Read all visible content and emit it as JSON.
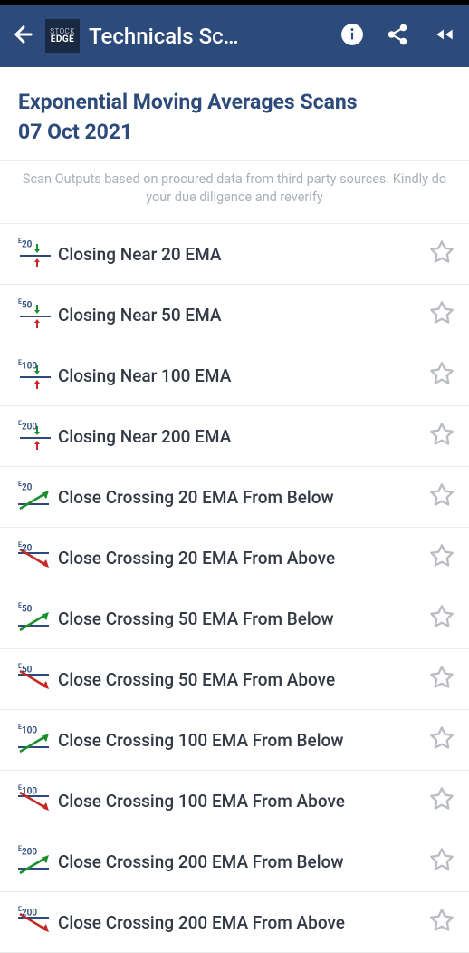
{
  "header": {
    "title": "Technicals Sc…",
    "logo_line1": "STOCK",
    "logo_line2": "EDGE"
  },
  "page": {
    "title_line1": "Exponential Moving Averages Scans",
    "title_line2": "07 Oct 2021",
    "disclaimer": "Scan Outputs based on procured data from third party sources. Kindly do your due diligence and reverify"
  },
  "scans": [
    {
      "period": "20",
      "label": "Closing Near 20 EMA",
      "icon": "near"
    },
    {
      "period": "50",
      "label": "Closing Near 50 EMA",
      "icon": "near"
    },
    {
      "period": "100",
      "label": "Closing Near 100 EMA",
      "icon": "near"
    },
    {
      "period": "200",
      "label": "Closing Near 200 EMA",
      "icon": "near"
    },
    {
      "period": "20",
      "label": "Close Crossing 20 EMA From Below",
      "icon": "cross-up"
    },
    {
      "period": "20",
      "label": "Close Crossing 20 EMA From Above",
      "icon": "cross-down"
    },
    {
      "period": "50",
      "label": "Close Crossing 50 EMA From Below",
      "icon": "cross-up"
    },
    {
      "period": "50",
      "label": "Close Crossing 50 EMA From Above",
      "icon": "cross-down"
    },
    {
      "period": "100",
      "label": "Close Crossing 100 EMA From Below",
      "icon": "cross-up"
    },
    {
      "period": "100",
      "label": "Close Crossing 100 EMA From Above",
      "icon": "cross-down"
    },
    {
      "period": "200",
      "label": "Close Crossing 200 EMA From Below",
      "icon": "cross-up"
    },
    {
      "period": "200",
      "label": "Close Crossing 200 EMA From Above",
      "icon": "cross-down"
    }
  ]
}
